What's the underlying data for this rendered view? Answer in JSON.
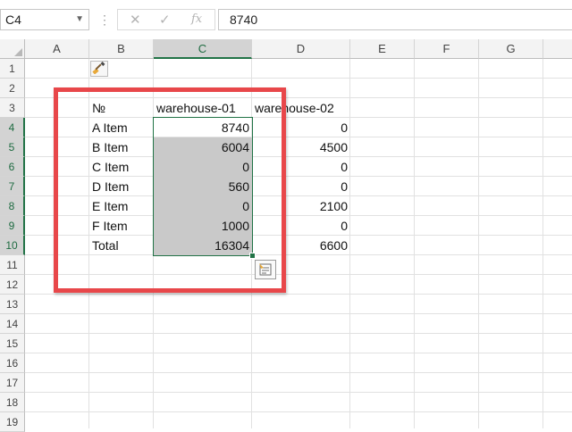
{
  "formula_bar": {
    "name_box": "C4",
    "formula": "8740",
    "cancel_icon": "✕",
    "enter_icon": "✓",
    "fx_label": "fx"
  },
  "columns": [
    "A",
    "B",
    "C",
    "D",
    "E",
    "F",
    "G"
  ],
  "rows": [
    "1",
    "2",
    "3",
    "4",
    "5",
    "6",
    "7",
    "8",
    "9",
    "10",
    "11",
    "12",
    "13",
    "14",
    "15",
    "16",
    "17",
    "18",
    "19"
  ],
  "cells": {
    "B3": "№",
    "C3": "warehouse-01",
    "D3": "warehouse-02",
    "B4": "A Item",
    "C4": "8740",
    "D4": "0",
    "B5": "B Item",
    "C5": "6004",
    "D5": "4500",
    "B6": "C Item",
    "C6": "0",
    "D6": "0",
    "B7": "D Item",
    "C7": "560",
    "D7": "0",
    "B8": "E Item",
    "C8": "0",
    "D8": "2100",
    "B9": "F Item",
    "C9": "1000",
    "D9": "0",
    "B10": "Total",
    "C10": "16304",
    "D10": "6600"
  },
  "selection": {
    "range": "C4:C10",
    "active_cell": "C4",
    "accent_color": "#217346"
  },
  "annotation": {
    "color": "#e8474a"
  },
  "icons": {
    "format_painter": "paintbrush-icon",
    "quick_analysis": "quick-analysis-icon"
  }
}
